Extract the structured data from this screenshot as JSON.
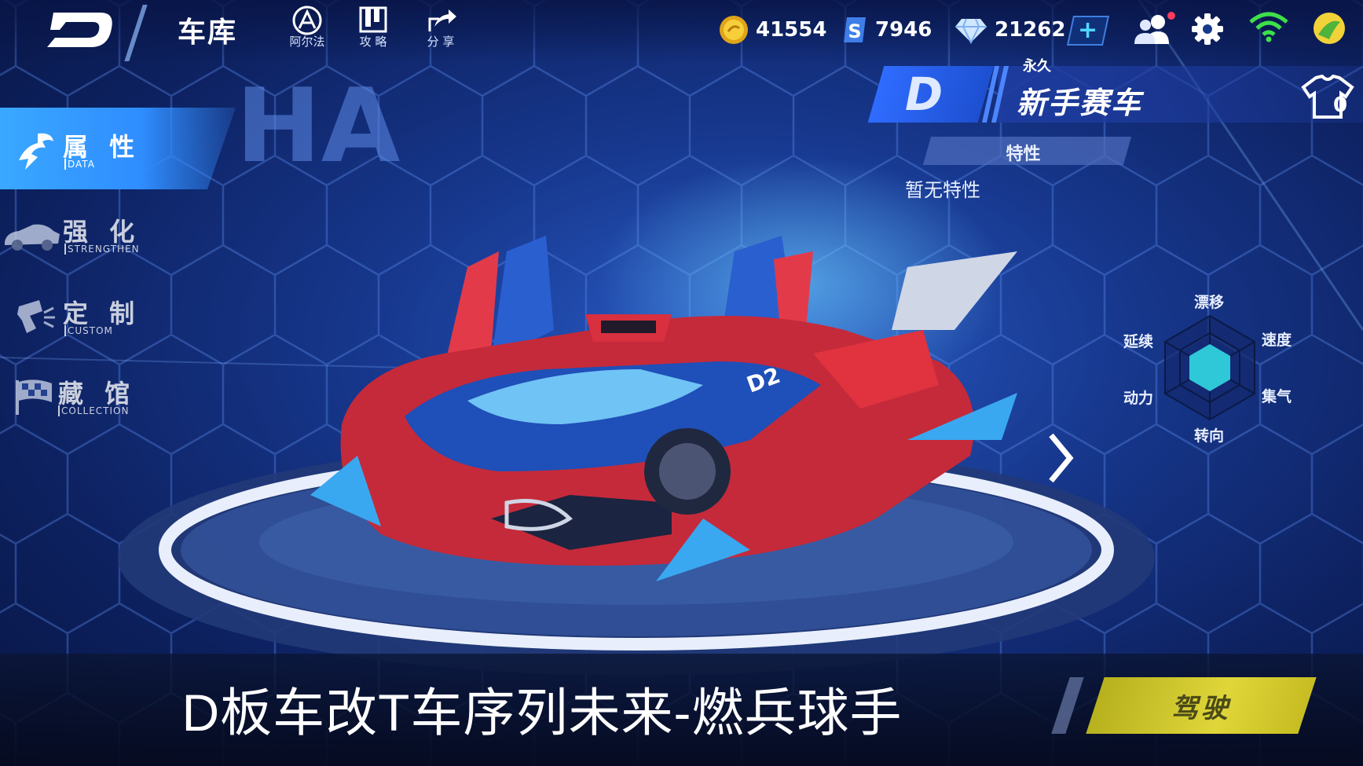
{
  "header": {
    "title": "车库",
    "nav": [
      {
        "label": "阿尔法",
        "icon": "alpha-icon"
      },
      {
        "label": "攻 略",
        "icon": "guide-book-icon"
      },
      {
        "label": "分 享",
        "icon": "share-icon"
      }
    ],
    "currencies": [
      {
        "name": "coins",
        "value": "41554",
        "icon": "gold-coin-icon"
      },
      {
        "name": "tickets",
        "value": "7946",
        "icon": "s-ticket-icon"
      },
      {
        "name": "diamonds",
        "value": "21262",
        "icon": "diamond-icon"
      }
    ]
  },
  "sidebar": {
    "items": [
      {
        "label": "属 性",
        "sublabel": "DATA",
        "active": true
      },
      {
        "label": "强 化",
        "sublabel": "STRENGTHEN",
        "active": false
      },
      {
        "label": "定 制",
        "sublabel": "CUSTOM",
        "active": false
      },
      {
        "label": "藏 馆",
        "sublabel": "COLLECTION",
        "active": false
      }
    ]
  },
  "car": {
    "rank": "D",
    "duration": "永久",
    "name": "新手赛车",
    "outfit_count": "0",
    "trait_header": "特性",
    "trait_value": "暂无特性"
  },
  "radar": {
    "labels": [
      "漂移",
      "速度",
      "集气",
      "转向",
      "动力",
      "延续"
    ]
  },
  "footer": {
    "caption": "D板车改T车序列未来-燃兵球手",
    "drive_label": "驾驶"
  },
  "colors": {
    "accent": "#3aa8ff",
    "drive": "#d6cc30",
    "radar_fill": "#2ec8d8"
  }
}
